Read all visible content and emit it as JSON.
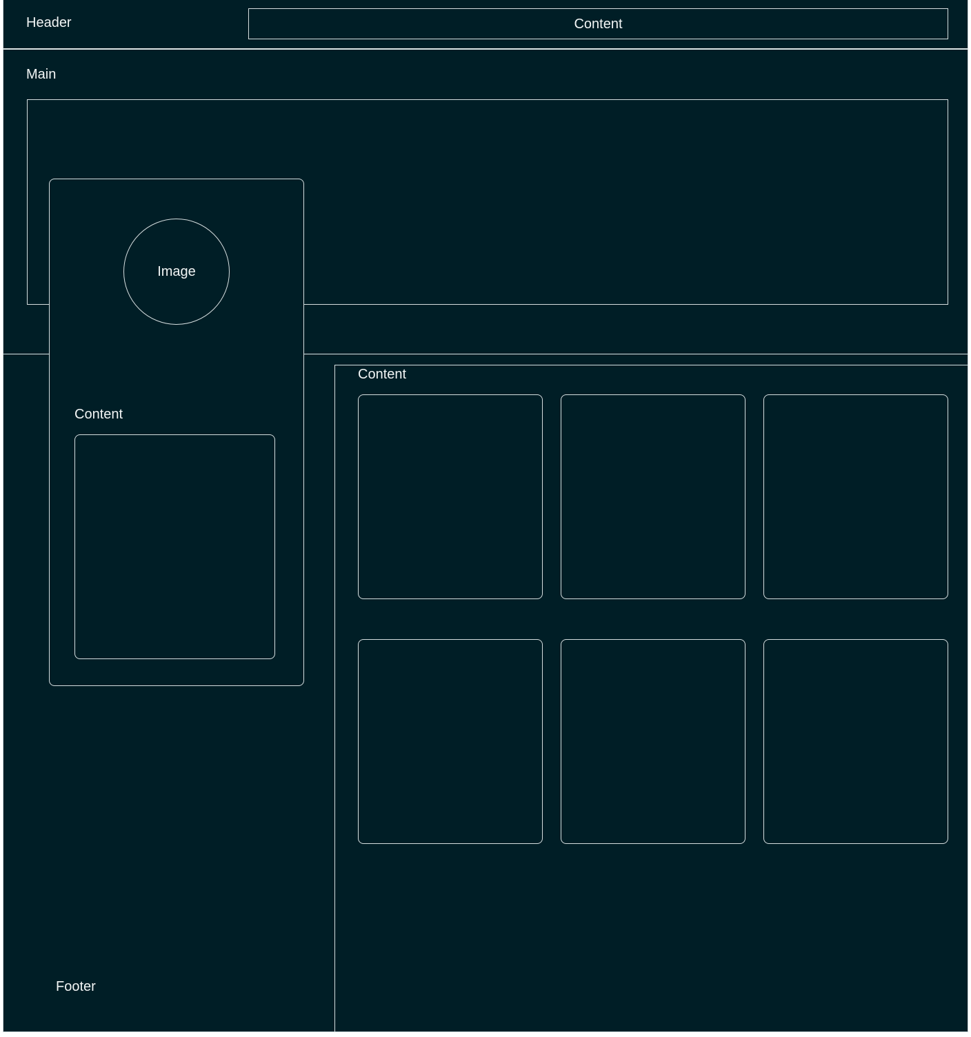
{
  "header": {
    "label": "Header",
    "content_label": "Content"
  },
  "main": {
    "label": "Main"
  },
  "sidebar": {
    "image_label": "Image",
    "content_label": "Content"
  },
  "content_panel": {
    "label": "Content",
    "cards": [
      {},
      {},
      {},
      {},
      {},
      {}
    ]
  },
  "footer": {
    "label": "Footer"
  },
  "colors": {
    "background": "#001e26",
    "outline": "#d7dfe0",
    "text": "#f2f5f5"
  }
}
